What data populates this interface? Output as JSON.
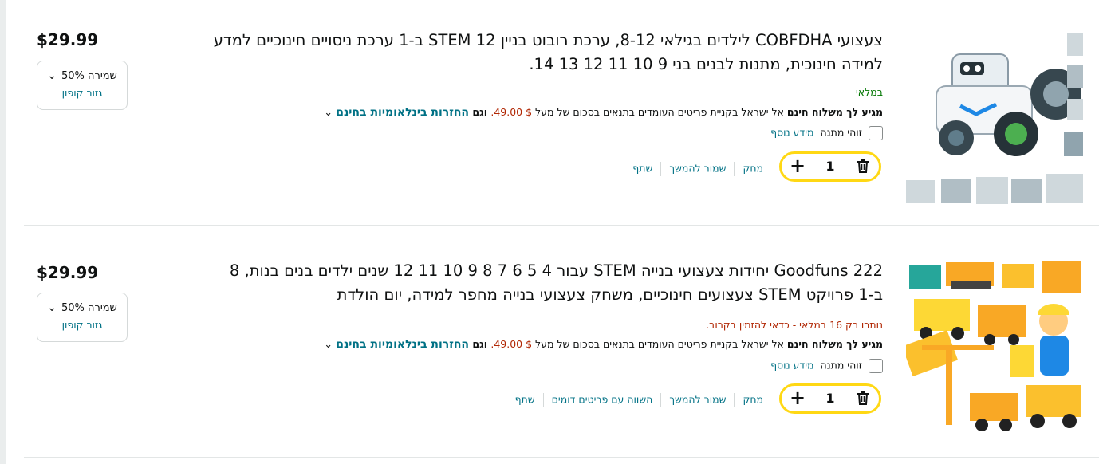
{
  "items": [
    {
      "title": "צעצועי COBFDHA לילדים בגילאי 8-12, ערכת רובוט בניין STEM 12 ב-1 ערכת ניסויים חינוכיים למדע למידה חינוכית, מתנות לבנים בני 9 10 11 12 13 14.",
      "price": "$29.99",
      "coupon_save": "שמירה 50%",
      "coupon_clip": "גזור קופון",
      "stock": "במלאי",
      "stock_color": "#007600",
      "ship_prefix": "מגיע לך משלוח חינם",
      "ship_text": " אל ישראל בקניית פריטים העומדים בתנאים בסכום של מעל ",
      "ship_amount": "$ 49.00.",
      "ship_and": " וגם ",
      "ship_returns": "החזרות בינלאומיות בחינם",
      "gift_label": "זוהי מתנה",
      "gift_more": "מידע נוסף",
      "qty": "1",
      "links": [
        "מחק",
        "שמור להמשך",
        "שתף"
      ]
    },
    {
      "title": "Goodfuns 222 יחידות צעצועי בנייה STEM עבור 4 5 6 7 8 9 10 11 12 שנים ילדים בנים בנות, 8 ב-1 פרויקט STEM צעצועים חינוכיים, משחק צעצועי בנייה מחפר למידה, יום הולדת",
      "price": "$29.99",
      "coupon_save": "שמירה 50%",
      "coupon_clip": "גזור קופון",
      "stock": "נותרו רק 16 במלאי - כדאי להזמין בקרוב.",
      "stock_color": "#b12704",
      "ship_prefix": "מגיע לך משלוח חינם",
      "ship_text": " אל ישראל בקניית פריטים העומדים בתנאים בסכום של מעל ",
      "ship_amount": "$ 49.00.",
      "ship_and": " וגם ",
      "ship_returns": "החזרות בינלאומיות בחינם",
      "gift_label": "זוהי מתנה",
      "gift_more": "מידע נוסף",
      "qty": "1",
      "links": [
        "מחק",
        "שמור להמשך",
        "השווה עם פריטים דומים",
        "שתף"
      ]
    }
  ],
  "colors": {
    "link": "#007185",
    "accent": "#ffd814",
    "price_red": "#b12704"
  }
}
